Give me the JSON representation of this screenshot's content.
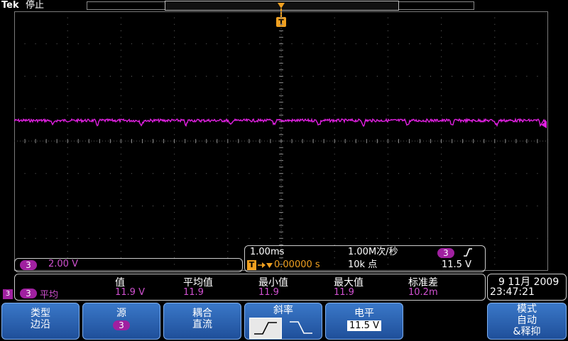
{
  "header": {
    "brand": "Tek",
    "status": "停止"
  },
  "trigger_marker": "T",
  "channel_scale": {
    "channel": "3",
    "value": "2.00 V"
  },
  "horizontal": {
    "time_per_div": "1.00ms",
    "sample_rate": "1.00M次/秒",
    "trigger_channel": "3",
    "trigger_slope_icon": "rising-edge-icon",
    "trigger_position_prefix": "T",
    "trigger_position": "0.00000 s",
    "record_length": "10k 点",
    "trigger_level": "11.5 V"
  },
  "measurement": {
    "headers": [
      "值",
      "平均值",
      "最小值",
      "最大值",
      "标准差"
    ],
    "row": {
      "channel": "3",
      "label": "平均",
      "values": [
        "11.9 V",
        "11.9",
        "11.9",
        "11.9",
        "10.2m"
      ]
    },
    "channel_indicator": "3"
  },
  "datetime": {
    "date": "9 11月 2009",
    "time": "23:47:21"
  },
  "menu": {
    "type": {
      "label": "类型",
      "value": "边沿"
    },
    "source": {
      "label": "源",
      "value": "3"
    },
    "coupling": {
      "label": "耦合",
      "value": "直流"
    },
    "slope": {
      "label": "斜率"
    },
    "level": {
      "label": "电平",
      "value": "11.5 V"
    },
    "mode": {
      "label": "模式",
      "value1": "自动",
      "value2": "&释抑"
    }
  },
  "colors": {
    "trace": "#e020e0",
    "graticule": "#7a7a7a",
    "trigger_marker": "#f0a020",
    "menu_blue": "#2a60b0"
  }
}
